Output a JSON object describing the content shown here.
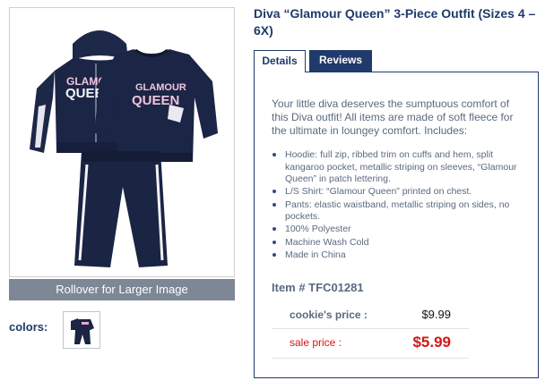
{
  "product": {
    "title": "Diva “Glamour Queen” 3-Piece Outfit (Sizes 4 – 6X)"
  },
  "image": {
    "rollover_label": "Rollover for Larger Image",
    "print_text_1": "GLAMOUR",
    "print_text_2": "QUEEN"
  },
  "colors": {
    "label": "colors:"
  },
  "tabs": [
    {
      "label": "Details",
      "active": true
    },
    {
      "label": "Reviews",
      "active": false
    }
  ],
  "details": {
    "description": "Your little diva deserves the sumptuous comfort of this Diva outfit! All items are made of soft fleece for the ultimate in loungey comfort. Includes:",
    "features": [
      "Hoodie: full zip, ribbed trim on cuffs and hem, split kangaroo pocket, metallic striping on sleeves, “Glamour Queen” in patch lettering.",
      "L/S Shirt: “Glamour Queen” printed on chest.",
      "Pants: elastic waistband, metallic striping on sides, no pockets.",
      "100% Polyester",
      "Machine Wash Cold",
      "Made in China"
    ],
    "item_number": "Item # TFC01281"
  },
  "pricing": {
    "regular_label": "cookie's price :",
    "regular_price": "$9.99",
    "sale_label": "sale price :",
    "sale_price": "$5.99"
  },
  "colors_palette": {
    "navy": "#1f3a6b",
    "garment": "#1b2545",
    "sale_red": "#d41616",
    "rollover_bg": "#7d8795"
  }
}
